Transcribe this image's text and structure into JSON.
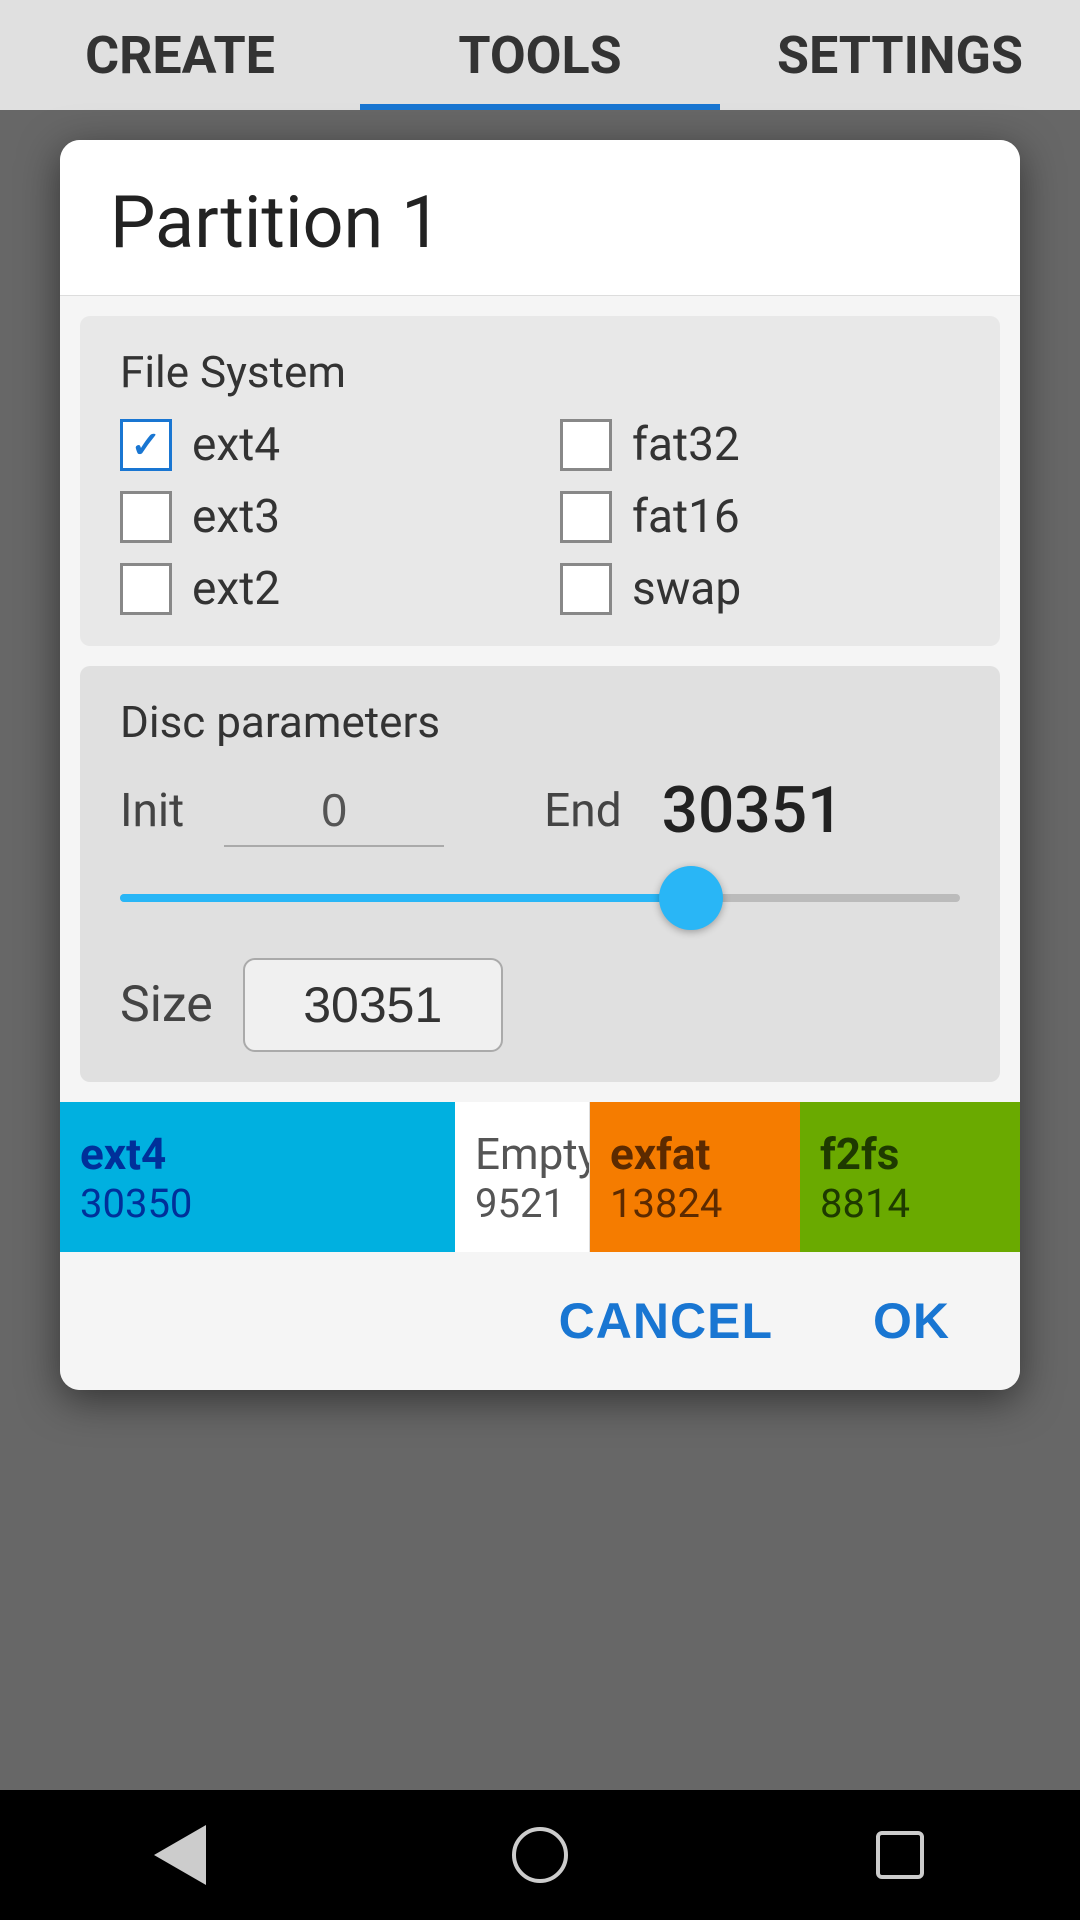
{
  "tabs": [
    {
      "id": "create",
      "label": "CREATE",
      "active": false
    },
    {
      "id": "tools",
      "label": "TOOLS",
      "active": true
    },
    {
      "id": "settings",
      "label": "SETTINGS",
      "active": false
    }
  ],
  "dialog": {
    "title": "Partition  1",
    "file_system": {
      "section_label": "File System",
      "options": [
        {
          "id": "ext4",
          "label": "ext4",
          "checked": true
        },
        {
          "id": "fat32",
          "label": "fat32",
          "checked": false
        },
        {
          "id": "ext3",
          "label": "ext3",
          "checked": false
        },
        {
          "id": "fat16",
          "label": "fat16",
          "checked": false
        },
        {
          "id": "ext2",
          "label": "ext2",
          "checked": false
        },
        {
          "id": "swap",
          "label": "swap",
          "checked": false
        }
      ]
    },
    "disc_parameters": {
      "section_label": "Disc parameters",
      "init_label": "Init",
      "init_value": "0",
      "end_label": "End",
      "end_value": "30351",
      "slider_percent": 68,
      "size_label": "Size",
      "size_value": "30351"
    },
    "partition_bar": {
      "segments": [
        {
          "id": "ext4",
          "name": "ext4",
          "size": "30350",
          "color": "#00b0e0",
          "text_color": "#00309a",
          "flex": 395
        },
        {
          "id": "empty",
          "name": "Empty",
          "size": "9521",
          "color": "#ffffff",
          "text_color": "#555555",
          "flex": 135
        },
        {
          "id": "exfat",
          "name": "exfat",
          "size": "13824",
          "color": "#f57c00",
          "text_color": "#5c2a00",
          "flex": 210
        },
        {
          "id": "f2fs",
          "name": "f2fs",
          "size": "8814",
          "color": "#6aaa00",
          "text_color": "#1e3a00",
          "flex": 1
        }
      ]
    },
    "actions": {
      "cancel_label": "CANCEL",
      "ok_label": "OK"
    }
  },
  "bottom_nav": {
    "back_title": "back",
    "home_title": "home",
    "recents_title": "recents"
  }
}
